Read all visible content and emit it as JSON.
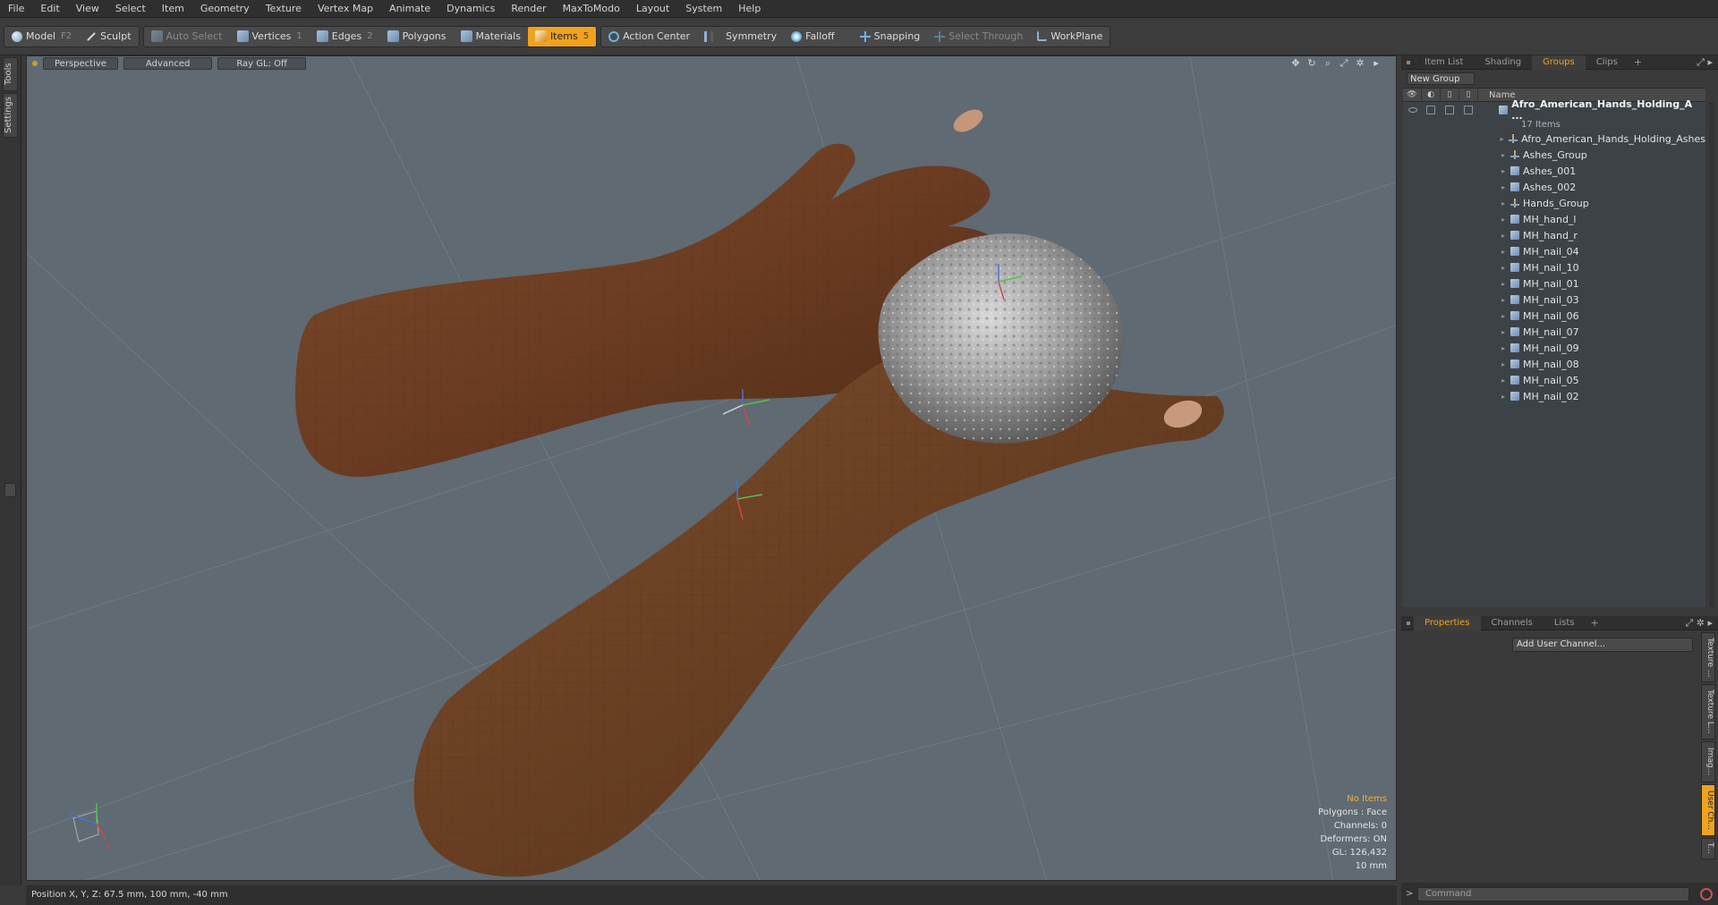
{
  "menu": [
    "File",
    "Edit",
    "View",
    "Select",
    "Item",
    "Geometry",
    "Texture",
    "Vertex Map",
    "Animate",
    "Dynamics",
    "Render",
    "MaxToModo",
    "Layout",
    "System",
    "Help"
  ],
  "toolbar": {
    "model": "Model",
    "model_key": "F2",
    "sculpt": "Sculpt",
    "auto_select": "Auto Select",
    "vertices": "Vertices",
    "vertices_key": "1",
    "edges": "Edges",
    "edges_key": "2",
    "polygons": "Polygons",
    "materials": "Materials",
    "items": "Items",
    "items_key": "5",
    "action_center": "Action Center",
    "symmetry": "Symmetry",
    "falloff": "Falloff",
    "snapping": "Snapping",
    "select_through": "Select Through",
    "workplane": "WorkPlane",
    "accent_color": "#f0a21e"
  },
  "left_tabs": [
    "Tools",
    "Settings"
  ],
  "viewport": {
    "view_mode": "Perspective",
    "shading": "Advanced",
    "raygl": "Ray GL: Off",
    "info": {
      "selection": "No Items",
      "polygons": "Polygons : Face",
      "channels": "Channels: 0",
      "deformers": "Deformers: ON",
      "gl": "GL: 126,432",
      "scale": "10 mm"
    },
    "background_color": "#5f6a72"
  },
  "statusbar": {
    "position": "Position X, Y, Z:  67.5 mm, 100 mm, -40 mm"
  },
  "top_panel": {
    "tabs": [
      "Item List",
      "Shading",
      "Groups",
      "Clips"
    ],
    "active_tab": "Groups",
    "new_group": "New Group",
    "name_header": "Name",
    "root": {
      "name": "Afro_American_Hands_Holding_A ...",
      "count": "17 Items"
    },
    "items": [
      {
        "name": "Afro_American_Hands_Holding_Ashes",
        "icon": "locator-icon"
      },
      {
        "name": "Ashes_Group",
        "icon": "locator-icon"
      },
      {
        "name": "Ashes_001",
        "icon": "mesh-icon"
      },
      {
        "name": "Ashes_002",
        "icon": "mesh-icon"
      },
      {
        "name": "Hands_Group",
        "icon": "locator-icon"
      },
      {
        "name": "MH_hand_l",
        "icon": "mesh-icon"
      },
      {
        "name": "MH_hand_r",
        "icon": "mesh-icon"
      },
      {
        "name": "MH_nail_04",
        "icon": "mesh-icon"
      },
      {
        "name": "MH_nail_10",
        "icon": "mesh-icon"
      },
      {
        "name": "MH_nail_01",
        "icon": "mesh-icon"
      },
      {
        "name": "MH_nail_03",
        "icon": "mesh-icon"
      },
      {
        "name": "MH_nail_06",
        "icon": "mesh-icon"
      },
      {
        "name": "MH_nail_07",
        "icon": "mesh-icon"
      },
      {
        "name": "MH_nail_09",
        "icon": "mesh-icon"
      },
      {
        "name": "MH_nail_08",
        "icon": "mesh-icon"
      },
      {
        "name": "MH_nail_05",
        "icon": "mesh-icon"
      },
      {
        "name": "MH_nail_02",
        "icon": "mesh-icon"
      }
    ]
  },
  "bottom_panel": {
    "tabs": [
      "Properties",
      "Channels",
      "Lists"
    ],
    "active_tab": "Properties",
    "add_channel": "Add User Channel...",
    "side_tabs": [
      "Texture ...",
      "Texture L...",
      "Imag...",
      "User Ch...",
      "T..."
    ],
    "active_side_tab": "User Ch..."
  },
  "command": {
    "placeholder": "Command"
  }
}
